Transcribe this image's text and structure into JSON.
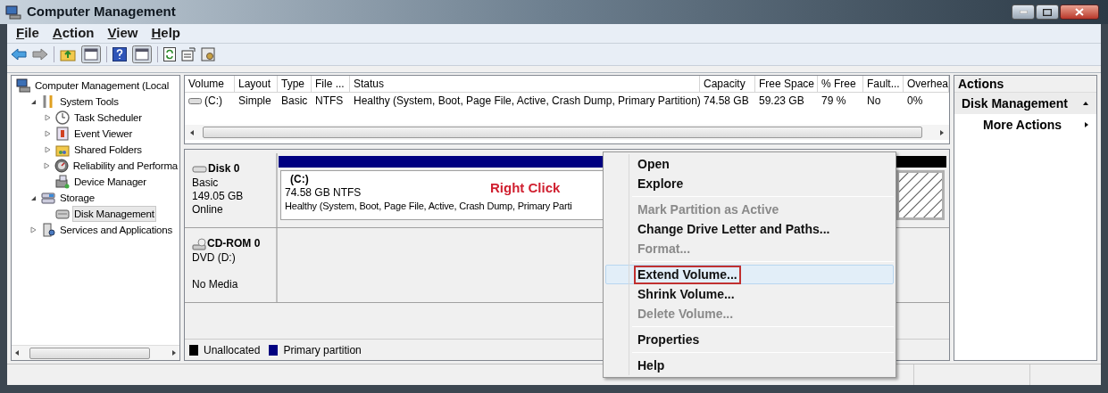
{
  "window": {
    "title": "Computer Management"
  },
  "menu": [
    "File",
    "Action",
    "View",
    "Help"
  ],
  "tree": [
    {
      "label": "Computer Management (Local",
      "selected": false,
      "children": [
        {
          "label": "System Tools",
          "selected": false,
          "expanded": true,
          "children": [
            {
              "label": "Task Scheduler",
              "selected": false,
              "expanded": false
            },
            {
              "label": "Event Viewer",
              "selected": false,
              "expanded": false
            },
            {
              "label": "Shared Folders",
              "selected": false,
              "expanded": false
            },
            {
              "label": "Reliability and Performa",
              "selected": false,
              "expanded": false
            },
            {
              "label": "Device Manager",
              "selected": false
            }
          ]
        },
        {
          "label": "Storage",
          "selected": false,
          "expanded": true,
          "children": [
            {
              "label": "Disk Management",
              "selected": true
            }
          ]
        },
        {
          "label": "Services and Applications",
          "selected": false,
          "expanded": false
        }
      ]
    }
  ],
  "volume_list": {
    "columns": [
      "Volume",
      "Layout",
      "Type",
      "File ...",
      "Status",
      "Capacity",
      "Free Space",
      "% Free",
      "Fault...",
      "Overhea"
    ],
    "rows": [
      {
        "cells": [
          "(C:)",
          "Simple",
          "Basic",
          "NTFS",
          "Healthy (System, Boot, Page File, Active, Crash Dump, Primary Partition)",
          "74.58 GB",
          "59.23 GB",
          "79 %",
          "No",
          "0%"
        ]
      }
    ]
  },
  "disks": [
    {
      "name": "Disk 0",
      "kind": "disk",
      "type": "Basic",
      "size": "149.05 GB",
      "status": "Online",
      "partitions": [
        {
          "kind": "primary",
          "label": "(C:)",
          "size": "74.58 GB NTFS",
          "status": "Healthy (System, Boot, Page File, Active, Crash Dump, Primary Parti"
        },
        {
          "kind": "unallocated"
        }
      ]
    },
    {
      "name": "CD-ROM 0",
      "kind": "cdrom",
      "type": "DVD (D:)",
      "status": "No Media"
    }
  ],
  "annotation": "Right Click",
  "legend": [
    {
      "label": "Unallocated",
      "color": "#000000"
    },
    {
      "label": "Primary partition",
      "color": "#000080"
    }
  ],
  "context_menu": [
    {
      "kind": "item",
      "label": "Open",
      "disabled": false,
      "selected": false,
      "annotated": false
    },
    {
      "kind": "item",
      "label": "Explore",
      "disabled": false,
      "selected": false,
      "annotated": false
    },
    {
      "kind": "separator"
    },
    {
      "kind": "item",
      "label": "Mark Partition as Active",
      "disabled": true,
      "selected": false,
      "annotated": false
    },
    {
      "kind": "item",
      "label": "Change Drive Letter and Paths...",
      "disabled": false,
      "selected": false,
      "annotated": false
    },
    {
      "kind": "item",
      "label": "Format...",
      "disabled": true,
      "selected": false,
      "annotated": false
    },
    {
      "kind": "separator"
    },
    {
      "kind": "item",
      "label": "Extend Volume...",
      "disabled": false,
      "selected": true,
      "annotated": true
    },
    {
      "kind": "item",
      "label": "Shrink Volume...",
      "disabled": false,
      "selected": false,
      "annotated": false
    },
    {
      "kind": "item",
      "label": "Delete Volume...",
      "disabled": true,
      "selected": false,
      "annotated": false
    },
    {
      "kind": "separator"
    },
    {
      "kind": "item",
      "label": "Properties",
      "disabled": false,
      "selected": false,
      "annotated": false
    },
    {
      "kind": "separator"
    },
    {
      "kind": "item",
      "label": "Help",
      "disabled": false,
      "selected": false,
      "annotated": false
    }
  ],
  "actions": {
    "title": "Actions",
    "sections": [
      {
        "label": "Disk Management",
        "expanded": true,
        "items": [
          "More Actions"
        ]
      }
    ]
  }
}
